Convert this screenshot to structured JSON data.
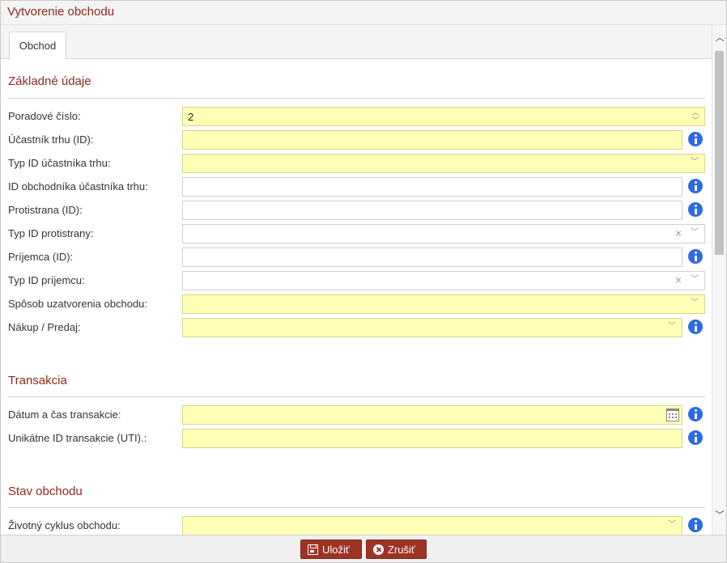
{
  "window": {
    "title": "Vytvorenie obchodu"
  },
  "tabs": [
    {
      "label": "Obchod"
    }
  ],
  "sections": {
    "basic": {
      "title": "Základné údaje",
      "fields": {
        "poradove_cislo": {
          "label": "Poradové číslo:",
          "value": "2"
        },
        "ucastnik_trhu": {
          "label": "Účastník trhu (ID):",
          "value": ""
        },
        "typ_id_ucastnika": {
          "label": "Typ ID účastníka trhu:",
          "value": ""
        },
        "id_obchodnika": {
          "label": "ID obchodníka účastníka trhu:",
          "value": ""
        },
        "protistrana": {
          "label": "Protistrana (ID):",
          "value": ""
        },
        "typ_id_protistrany": {
          "label": "Typ ID protistrany:",
          "value": ""
        },
        "prijemca": {
          "label": "Príjemca (ID):",
          "value": ""
        },
        "typ_id_prijemcu": {
          "label": "Typ ID príjemcu:",
          "value": ""
        },
        "sposob_uzatvorenia": {
          "label": "Spôsob uzatvorenia obchodu:",
          "value": ""
        },
        "nakup_predaj": {
          "label": "Nákup / Predaj:",
          "value": ""
        }
      }
    },
    "transaction": {
      "title": "Transakcia",
      "fields": {
        "datum_cas": {
          "label": "Dátum a čas transakcie:",
          "value": ""
        },
        "uti": {
          "label": "Unikátne ID transakcie (UTI).:",
          "value": ""
        }
      }
    },
    "status": {
      "title": "Stav obchodu",
      "fields": {
        "zivotny_cyklus": {
          "label": "Životný cyklus obchodu:",
          "value": ""
        }
      }
    }
  },
  "footer": {
    "save_label": "Uložiť",
    "cancel_label": "Zrušiť"
  },
  "colors": {
    "accent": "#9e3325",
    "title": "#8e2a1e",
    "required_bg": "#ffffb5",
    "info": "#2d6be0"
  },
  "icons": {
    "info": "info-icon",
    "chevron": "chevron-down-icon",
    "clear": "clear-icon",
    "calendar": "calendar-icon",
    "save": "save-icon",
    "cancel": "cancel-icon"
  }
}
